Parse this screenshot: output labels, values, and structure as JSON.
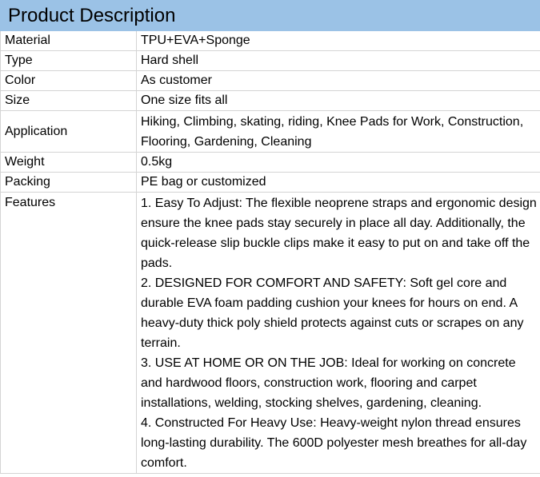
{
  "header": {
    "title": "Product Description"
  },
  "rows": [
    {
      "label": "Material",
      "value": "TPU+EVA+Sponge"
    },
    {
      "label": "Type",
      "value": "Hard shell"
    },
    {
      "label": "Color",
      "value": "As customer"
    },
    {
      "label": "Size",
      "value": "One size fits all"
    },
    {
      "label": "Application",
      "value": "Hiking, Climbing, skating, riding, Knee Pads for Work, Construction, Flooring, Gardening, Cleaning"
    },
    {
      "label": "Weight",
      "value": "0.5kg"
    },
    {
      "label": "Packing",
      "value": "PE bag or customized"
    }
  ],
  "features": {
    "label": "Features",
    "items": [
      "1. Easy To Adjust: The flexible neoprene straps and ergonomic design ensure the knee pads stay securely in place all day. Additionally, the quick-release slip buckle clips make it easy to put on and take off the pads.",
      "2. DESIGNED FOR COMFORT AND SAFETY: Soft gel core and durable EVA foam padding cushion your knees for hours on end. A heavy-duty thick poly shield protects against cuts or scrapes on any terrain.",
      "3. USE AT HOME OR ON THE JOB: Ideal for working on concrete and hardwood floors, construction work, flooring and carpet installations, welding, stocking shelves, gardening, cleaning.",
      "4. Constructed For Heavy Use: Heavy-weight nylon thread ensures long-lasting durability. The 600D polyester mesh breathes for all-day comfort."
    ]
  }
}
